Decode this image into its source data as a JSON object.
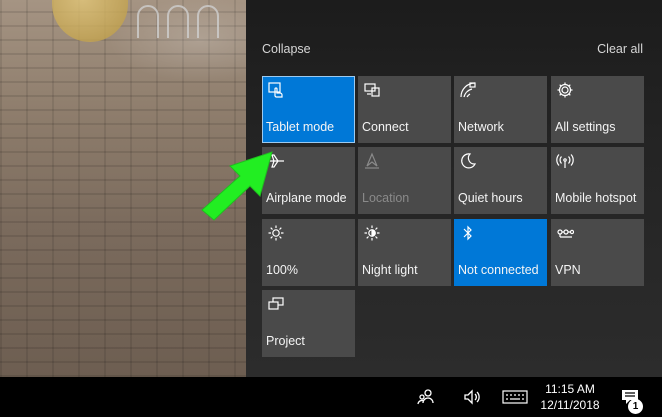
{
  "action_center": {
    "collapse": "Collapse",
    "clear_all": "Clear all",
    "tiles": [
      {
        "label": "Tablet mode",
        "icon": "tablet-mode-icon",
        "state": "on"
      },
      {
        "label": "Connect",
        "icon": "connect-icon",
        "state": "off"
      },
      {
        "label": "Network",
        "icon": "network-icon",
        "state": "off"
      },
      {
        "label": "All settings",
        "icon": "gear-icon",
        "state": "off"
      },
      {
        "label": "Airplane mode",
        "icon": "airplane-icon",
        "state": "off"
      },
      {
        "label": "Location",
        "icon": "location-icon",
        "state": "disabled"
      },
      {
        "label": "Quiet hours",
        "icon": "moon-icon",
        "state": "off"
      },
      {
        "label": "Mobile hotspot",
        "icon": "hotspot-icon",
        "state": "off"
      },
      {
        "label": "100%",
        "icon": "brightness-icon",
        "state": "off"
      },
      {
        "label": "Night light",
        "icon": "night-light-icon",
        "state": "off"
      },
      {
        "label": "Not connected",
        "icon": "bluetooth-icon",
        "state": "on"
      },
      {
        "label": "VPN",
        "icon": "vpn-icon",
        "state": "off"
      },
      {
        "label": "Project",
        "icon": "project-icon",
        "state": "off"
      }
    ]
  },
  "taskbar": {
    "time": "11:15 AM",
    "date": "12/11/2018",
    "notification_count": "1"
  },
  "colors": {
    "accent": "#0078d7",
    "tile_off": "#4a4a4a",
    "annotation_arrow": "#22ee22"
  }
}
